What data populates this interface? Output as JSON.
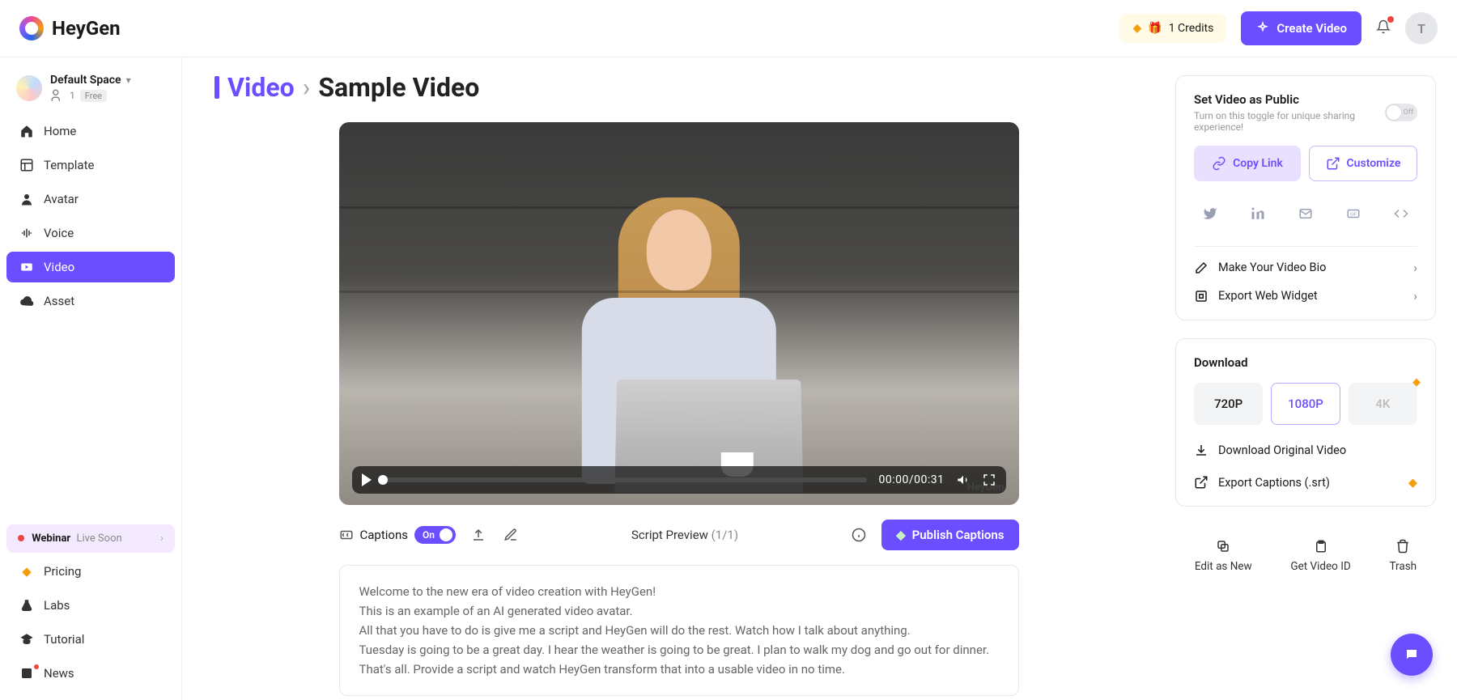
{
  "header": {
    "brand": "HeyGen",
    "credits_label": "1 Credits",
    "create_video": "Create Video",
    "avatar_letter": "T"
  },
  "space": {
    "name": "Default Space",
    "count": "1",
    "plan": "Free"
  },
  "sidebar": {
    "items": [
      {
        "label": "Home"
      },
      {
        "label": "Template"
      },
      {
        "label": "Avatar"
      },
      {
        "label": "Voice"
      },
      {
        "label": "Video"
      },
      {
        "label": "Asset"
      }
    ],
    "webinar_label": "Webinar",
    "webinar_status": "Live Soon",
    "bottom": [
      {
        "label": "Pricing"
      },
      {
        "label": "Labs"
      },
      {
        "label": "Tutorial"
      },
      {
        "label": "News"
      }
    ]
  },
  "breadcrumb": {
    "root": "Video",
    "separator": "›",
    "title": "Sample Video"
  },
  "player": {
    "time": "00:00/00:31",
    "watermark": "HeyGen"
  },
  "captions": {
    "label": "Captions",
    "state": "On",
    "script_preview": "Script Preview",
    "script_count": "(1/1)",
    "publish": "Publish Captions"
  },
  "script_text": "Welcome to the new era of video creation with HeyGen!\nThis is an example of an AI generated video avatar.\nAll that you have to do is give me a script and HeyGen will do the rest. Watch how I talk about anything.\nTuesday is going to be a great day. I hear the weather is going to be great. I plan to walk my dog and go out for dinner.\nThat's all. Provide a script and watch HeyGen transform that into a usable video in no time.",
  "share_panel": {
    "title": "Set Video as Public",
    "subtitle": "Turn on this toggle for unique sharing experience!",
    "toggle_label": "Off",
    "copy_link": "Copy Link",
    "customize": "Customize",
    "bio": "Make Your Video Bio",
    "widget": "Export Web Widget"
  },
  "download_panel": {
    "title": "Download",
    "res": [
      "720P",
      "1080P",
      "4K"
    ],
    "original": "Download Original Video",
    "captions": "Export Captions (.srt)"
  },
  "actions": {
    "edit": "Edit as New",
    "get_id": "Get Video ID",
    "trash": "Trash"
  }
}
